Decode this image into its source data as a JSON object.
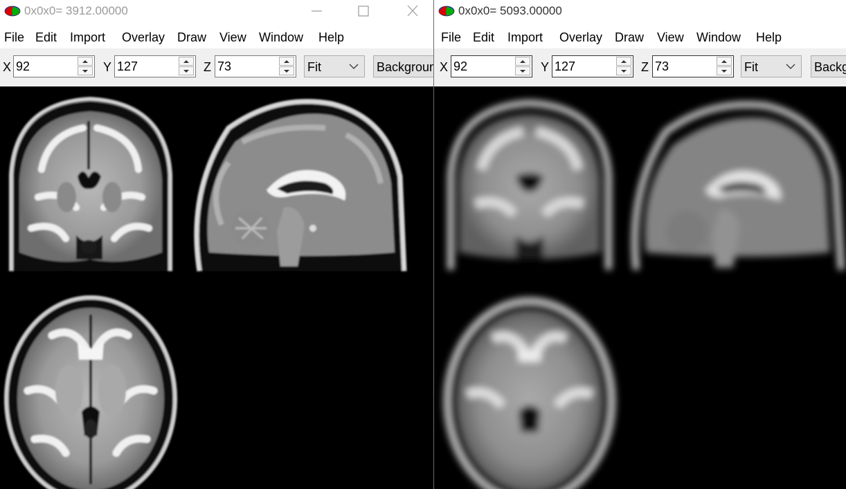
{
  "windows": [
    {
      "title": "0x0x0= 3912.00000",
      "menu": [
        "File",
        "Edit",
        "Import",
        "Overlay",
        "Draw",
        "View",
        "Window",
        "Help"
      ],
      "coords": {
        "x_label": "X",
        "x_value": "92",
        "y_label": "Y",
        "y_value": "127",
        "z_label": "Z",
        "z_value": "73"
      },
      "zoom": "Fit",
      "background_button": "Backgroun",
      "views": [
        "coronal",
        "sagittal",
        "axial"
      ],
      "blurred": false
    },
    {
      "title": "0x0x0= 5093.00000",
      "menu": [
        "File",
        "Edit",
        "Import",
        "Overlay",
        "Draw",
        "View",
        "Window",
        "Help"
      ],
      "coords": {
        "x_label": "X",
        "x_value": "92",
        "y_label": "Y",
        "y_value": "127",
        "z_label": "Z",
        "z_value": "73"
      },
      "zoom": "Fit",
      "background_button": "Backg",
      "views": [
        "coronal",
        "sagittal",
        "axial"
      ],
      "blurred": true
    }
  ],
  "icons": {
    "app": "brain-logo-icon",
    "minimize": "minimize-icon",
    "maximize": "maximize-icon",
    "close": "close-icon",
    "spin_up": "spin-up-icon",
    "spin_down": "spin-down-icon",
    "dropdown": "chevron-down-icon"
  },
  "colors": {
    "canvas": "#000000",
    "toolbar": "#f0f0f0",
    "titlebar": "#ffffff"
  }
}
